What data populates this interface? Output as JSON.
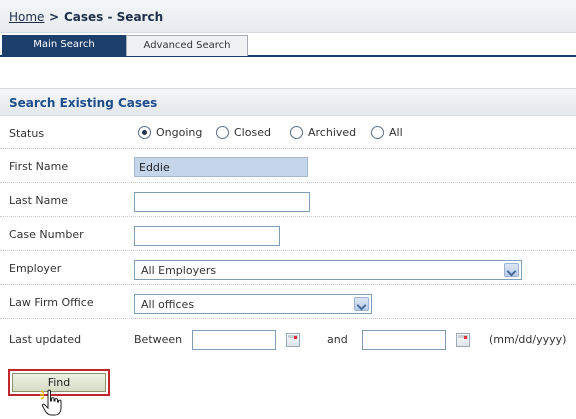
{
  "breadcrumb": {
    "home": "Home",
    "separator": ">",
    "current": "Cases - Search"
  },
  "tabs": [
    {
      "label": "Main Search",
      "active": true
    },
    {
      "label": "Advanced Search",
      "active": false
    }
  ],
  "section": {
    "title": "Search Existing Cases"
  },
  "form": {
    "status": {
      "label": "Status",
      "options": [
        "Ongoing",
        "Closed",
        "Archived",
        "All"
      ],
      "selected": "Ongoing"
    },
    "first_name": {
      "label": "First Name",
      "value": "Eddie"
    },
    "last_name": {
      "label": "Last Name",
      "value": ""
    },
    "case_number": {
      "label": "Case Number",
      "value": ""
    },
    "employer": {
      "label": "Employer",
      "selected": "All Employers"
    },
    "law_firm_office": {
      "label": "Law Firm Office",
      "selected": "All offices"
    },
    "last_updated": {
      "label": "Last updated",
      "between_label": "Between",
      "and_label": "and",
      "format_hint": "(mm/dd/yyyy)",
      "from_value": "",
      "to_value": ""
    }
  },
  "find_button": {
    "label": "Find"
  },
  "colors": {
    "tab_active_bg": "#1d3f6c",
    "section_title": "#1e4d8c",
    "highlight_border": "#c0262d",
    "filled_input_bg": "#c5d5ea"
  },
  "icons": [
    "calendar-icon",
    "dropdown-arrow-icon",
    "hand-pointer-icon"
  ]
}
